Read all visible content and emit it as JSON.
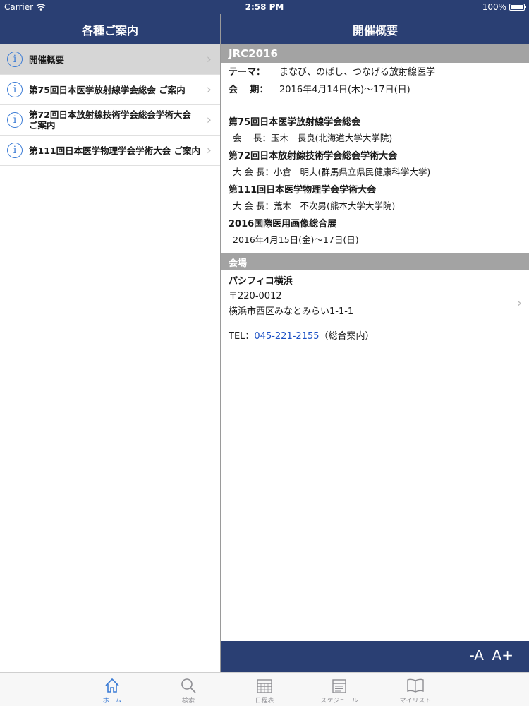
{
  "status": {
    "carrier": "Carrier",
    "time": "2:58 PM",
    "battery": "100%",
    "battery_level": 1.0
  },
  "master": {
    "title": "各種ご案内",
    "items": [
      {
        "label": "開催概要",
        "selected": true
      },
      {
        "label": "第75回日本医学放射線学会総会 ご案内",
        "selected": false
      },
      {
        "label": "第72回日本放射線技術学会総会学術大会 ご案内",
        "selected": false
      },
      {
        "label": "第111回日本医学物理学会学術大会 ご案内",
        "selected": false
      }
    ]
  },
  "detail": {
    "title": "開催概要",
    "section_title": "JRC2016",
    "theme_key": "テーマ：",
    "theme_value": "まなび、のばし、つなげる放射線医学",
    "period_key": "会　 期：",
    "period_value": "2016年4月14日(木)〜17日(日)",
    "orgs": [
      {
        "title": "第75回日本医学放射線学会総会",
        "sub": "会　 長：玉木　長良(北海道大学大学院)"
      },
      {
        "title": "第72回日本放射線技術学会総会学術大会",
        "sub": "大 会 長：小倉　明夫(群馬県立県民健康科学大学)"
      },
      {
        "title": "第111回日本医学物理学会学術大会",
        "sub": "大 会 長：荒木　不次男(熊本大学大学院)"
      },
      {
        "title": "2016国際医用画像総合展",
        "sub": "2016年4月15日(金)〜17日(日)"
      }
    ],
    "venue_header": "会場",
    "venue_name": "パシフィコ横浜",
    "venue_postal": "〒220-0012",
    "venue_address": "横浜市西区みなとみらい1-1-1",
    "tel_prefix": "TEL：",
    "tel_number": "045-221-2155",
    "tel_suffix": "（総合案内）",
    "font_minus": "-A",
    "font_plus": "A+"
  },
  "tabs": [
    {
      "label": "ホーム",
      "icon": "home-icon",
      "active": true
    },
    {
      "label": "検索",
      "icon": "search-icon",
      "active": false
    },
    {
      "label": "日程表",
      "icon": "calendar-icon",
      "active": false
    },
    {
      "label": "スケジュール",
      "icon": "schedule-icon",
      "active": false
    },
    {
      "label": "マイリスト",
      "icon": "book-icon",
      "active": false
    }
  ],
  "colors": {
    "navbar": "#2a3f73",
    "section_header": "#a3a3a3",
    "accent": "#3a7bd5",
    "link": "#1a4fc4"
  }
}
